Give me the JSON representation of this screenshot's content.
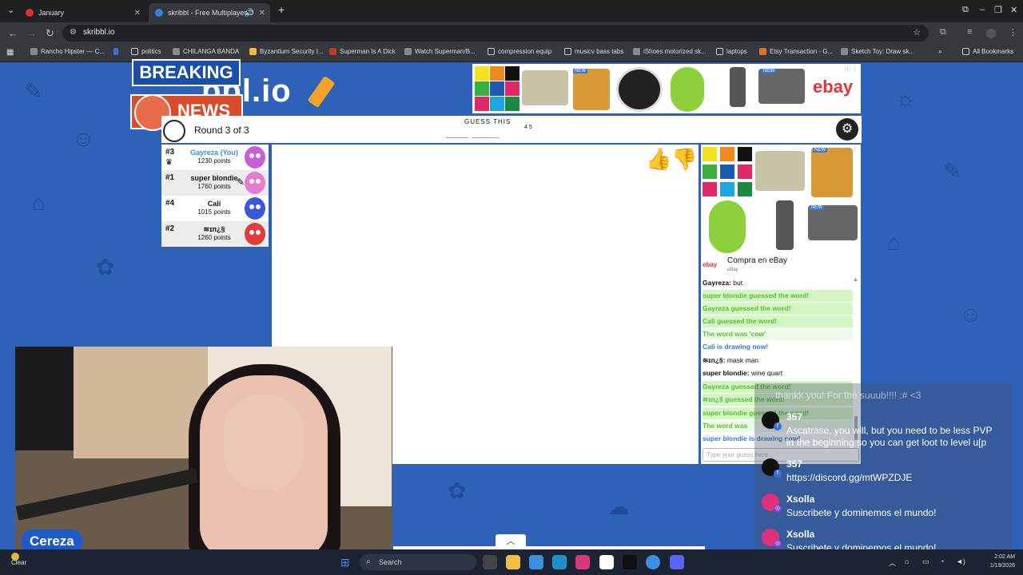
{
  "browser": {
    "tabs": [
      {
        "title": "January",
        "favicon_color": "#e03030"
      },
      {
        "title": "skribbl - Free Multiplayer D",
        "favicon_color": "#3a7de0"
      }
    ],
    "new_tab": "+",
    "url": "skribbl.io",
    "bookmarks": [
      "Rancho Hipster — C...",
      "politics",
      "CHILANGA BANDA",
      "Byzantium Security I...",
      "Superman Is A Dick",
      "Watch Superman/B...",
      "compression equip",
      "musicv bass tabs",
      "iShoes motorized sk...",
      "laptops",
      "Etsy Transaction - G...",
      "Sketch Toy: Draw sk..."
    ],
    "all_bookmarks": "All Bookmarks"
  },
  "logo": {
    "text": "bbl.io",
    "breaking": "BREAKING",
    "news": "NEWS"
  },
  "game": {
    "round": "Round 3 of 3",
    "guess_label": "GUESS THIS",
    "word_blanks": "____ _____",
    "word_lengths": "4 5"
  },
  "players": [
    {
      "rank": "#3",
      "name": "Gayreza (You)",
      "points": "1230 points",
      "color": "#c95ed8",
      "is_you": true
    },
    {
      "rank": "#1",
      "name": "super blondie",
      "points": "1760 points",
      "color": "#e87ad4",
      "is_you": false
    },
    {
      "rank": "#4",
      "name": "Cali",
      "points": "1015 points",
      "color": "#3b58d8",
      "is_you": false
    },
    {
      "rank": "#2",
      "name": "≋ɪᴨ¿§",
      "points": "1260 points",
      "color": "#e03c3c",
      "is_you": false
    }
  ],
  "ads": {
    "ebay_title": "Compra en eBay",
    "ebay_sub": "eBay",
    "new_badge": "NEW",
    "ebay_logo": "ebay"
  },
  "chat": [
    {
      "kind": "plain",
      "name": "Gayreza:",
      "text": "but"
    },
    {
      "kind": "guess",
      "text": "super blondie guessed the word!"
    },
    {
      "kind": "guess",
      "text": "Gayreza guessed the word!"
    },
    {
      "kind": "guess",
      "text": "Cali guessed the word!"
    },
    {
      "kind": "word",
      "text": "The word was 'cow'"
    },
    {
      "kind": "draw",
      "text": "Cali is drawing now!"
    },
    {
      "kind": "plain",
      "name": "≋ɪᴨ¿§:",
      "text": "mask man"
    },
    {
      "kind": "plain",
      "name": "super blondie:",
      "text": "wine quart"
    },
    {
      "kind": "guess",
      "text": "Gayreza guessed the word!"
    },
    {
      "kind": "guess",
      "text": "≋ɪᴨ¿§ guessed the word!"
    },
    {
      "kind": "guess",
      "text": "super blondie guessed the word!"
    },
    {
      "kind": "word",
      "text": "The word was"
    },
    {
      "kind": "draw",
      "text": "super blondie is drawing now!"
    }
  ],
  "chat_placeholder": "Type your guess here...",
  "streamer": {
    "name": "Cereza"
  },
  "stream_chat": [
    {
      "name": "",
      "msg": "thankk you! For the suuub!!!! :# <3",
      "avatar_color": "#444"
    },
    {
      "name": "357",
      "msg": "Ascatrase, you will, but you need to be less PVP",
      "msg2": "in the beginning so you can get loot to level u[p",
      "avatar_color": "#111"
    },
    {
      "name": "357",
      "msg": "https://discord.gg/mtWPZDJE",
      "avatar_color": "#111"
    },
    {
      "name": "Xsolla",
      "msg": "Suscribete y dominemos el mundo!",
      "avatar_color": "#e0307a"
    },
    {
      "name": "Xsolla",
      "msg": "Suscribete y dominemos el mundo!",
      "avatar_color": "#e0307a"
    }
  ],
  "taskbar": {
    "weather": "Clear",
    "search": "Search",
    "time": "2:02 AM",
    "date": "1/19/2026"
  }
}
